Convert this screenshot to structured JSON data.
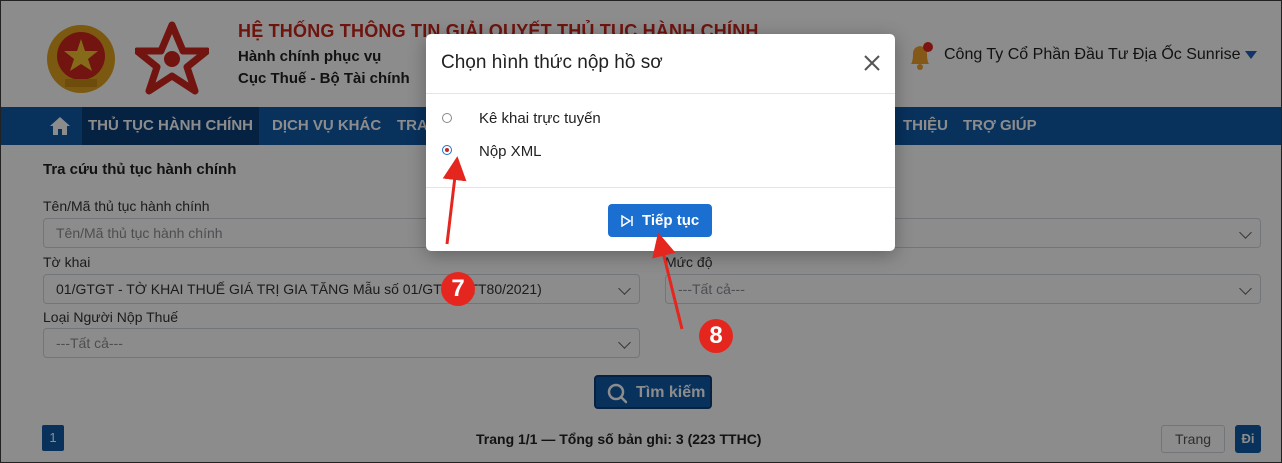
{
  "header": {
    "system_title": "HỆ THỐNG THÔNG TIN GIẢI QUYẾT THỦ TỤC HÀNH CHÍNH",
    "subtitle_line1": "Hành chính phục vụ",
    "subtitle_line2": "Cục Thuế - Bộ Tài chính",
    "company_name": "Công Ty Cổ Phần Đầu Tư Địa Ốc Sunrise"
  },
  "nav": {
    "items": [
      {
        "label": "THỦ TỤC HÀNH CHÍNH"
      },
      {
        "label": "DỊCH VỤ KHÁC"
      },
      {
        "label": "TRA"
      },
      {
        "label": "THIỆU"
      },
      {
        "label": "TRỢ GIÚP"
      }
    ]
  },
  "search_form": {
    "title": "Tra cứu thủ tục hành chính",
    "name_label": "Tên/Mã thủ tục hành chính",
    "name_placeholder": "Tên/Mã thủ tục hành chính",
    "declaration_label": "Tờ khai",
    "declaration_value": "01/GTGT - TỜ KHAI THUẾ GIÁ TRỊ GIA TĂNG Mẫu số 01/GTGT (TT80/2021)",
    "level_label": "Mức độ",
    "level_value": "---Tất cả---",
    "taxpayer_type_label": "Loại Người Nộp Thuế",
    "taxpayer_type_value": "---Tất cả---",
    "search_button": "Tìm kiếm"
  },
  "pagination": {
    "current_page": "1",
    "summary": "Trang 1/1 — Tổng số bản ghi: 3 (223 TTHC)",
    "page_input_placeholder": "Trang",
    "go_button": "Đi"
  },
  "modal": {
    "title": "Chọn hình thức nộp hồ sơ",
    "options": [
      {
        "label": "Kê khai trực tuyến",
        "selected": false
      },
      {
        "label": "Nộp XML",
        "selected": true
      }
    ],
    "continue_button": "Tiếp tục"
  },
  "annotations": {
    "step_7": "7",
    "step_8": "8"
  },
  "colors": {
    "nav_bg": "#0f5aa8",
    "title_red": "#c8261d",
    "primary_button": "#1a6fd0",
    "badge_red": "#e5261f",
    "arrow_red": "#e5261f"
  }
}
